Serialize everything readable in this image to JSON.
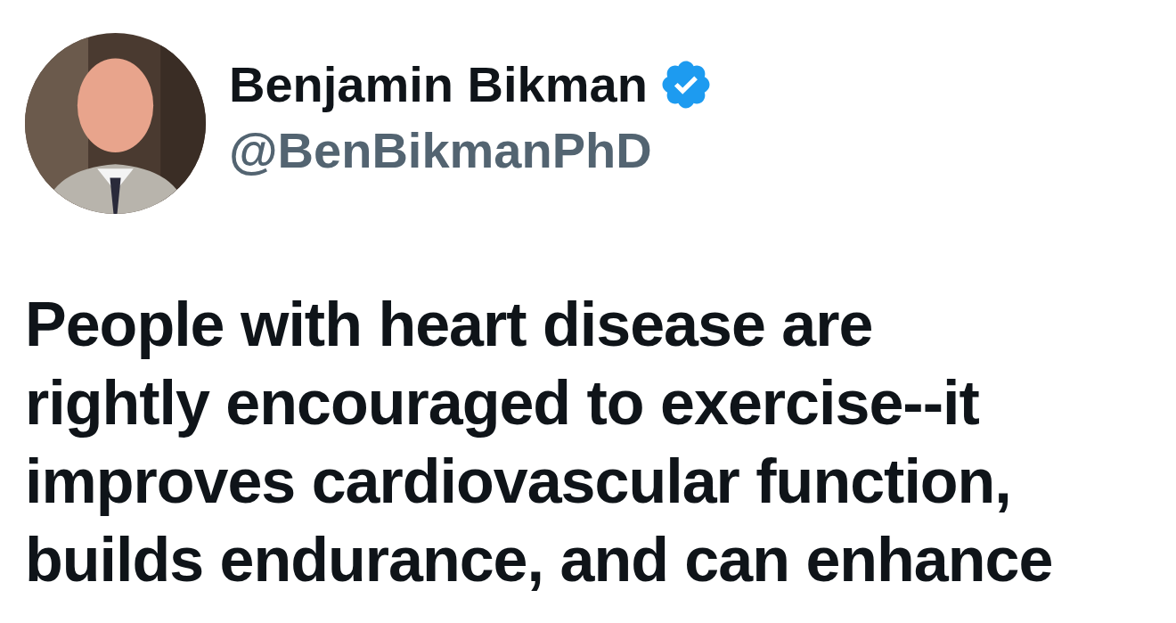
{
  "author": {
    "name": "Benjamin Bikman",
    "verified": true,
    "handle": "@BenBikmanPhD"
  },
  "tweet": {
    "text": "People with heart disease are rightly encouraged to exercise--it improves cardiovascular function, builds endurance, and can enhance"
  }
}
